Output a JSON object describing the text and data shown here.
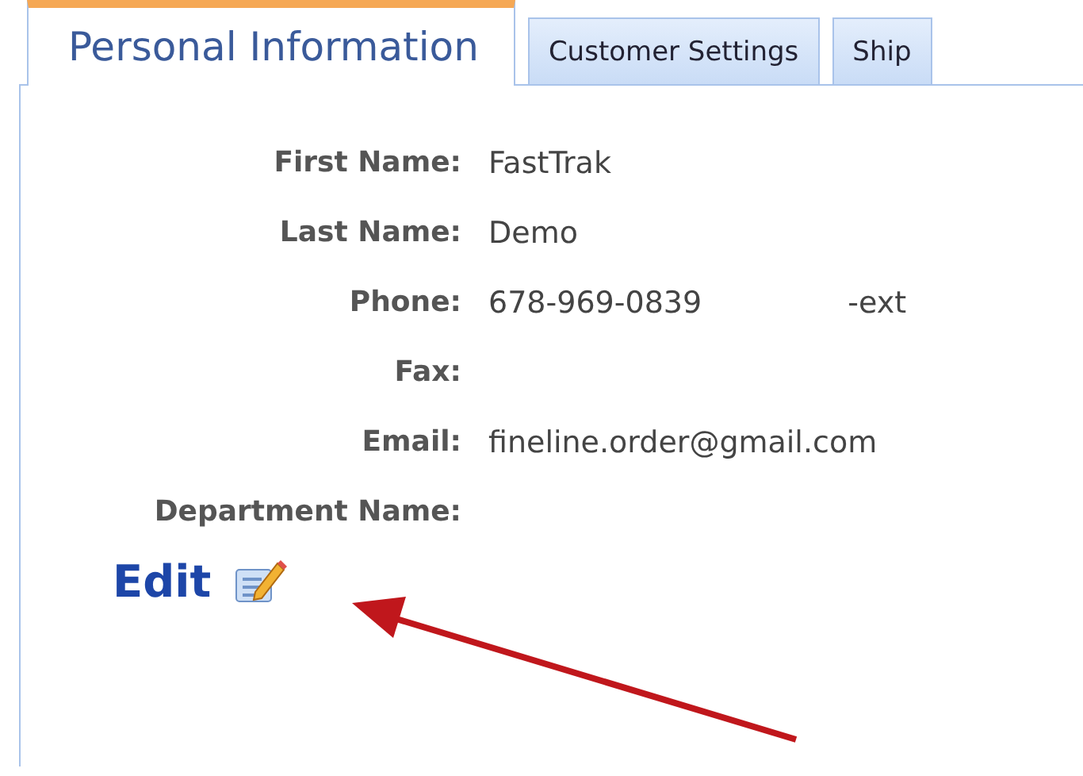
{
  "tabs": [
    {
      "label": "Personal Information",
      "selected": true
    },
    {
      "label": "Customer Settings",
      "selected": false
    },
    {
      "label": "Ship",
      "selected": false
    }
  ],
  "fields": [
    {
      "label": "First Name:",
      "value": "FastTrak"
    },
    {
      "label": "Last Name:",
      "value": "Demo"
    },
    {
      "label": "Phone:",
      "value": "678-969-0839",
      "extra": "-ext"
    },
    {
      "label": "Fax:"
    },
    {
      "label": "Email:",
      "value": "fineline.order@gmail.com"
    },
    {
      "label": "Department Name:"
    }
  ],
  "edit_link": "Edit"
}
